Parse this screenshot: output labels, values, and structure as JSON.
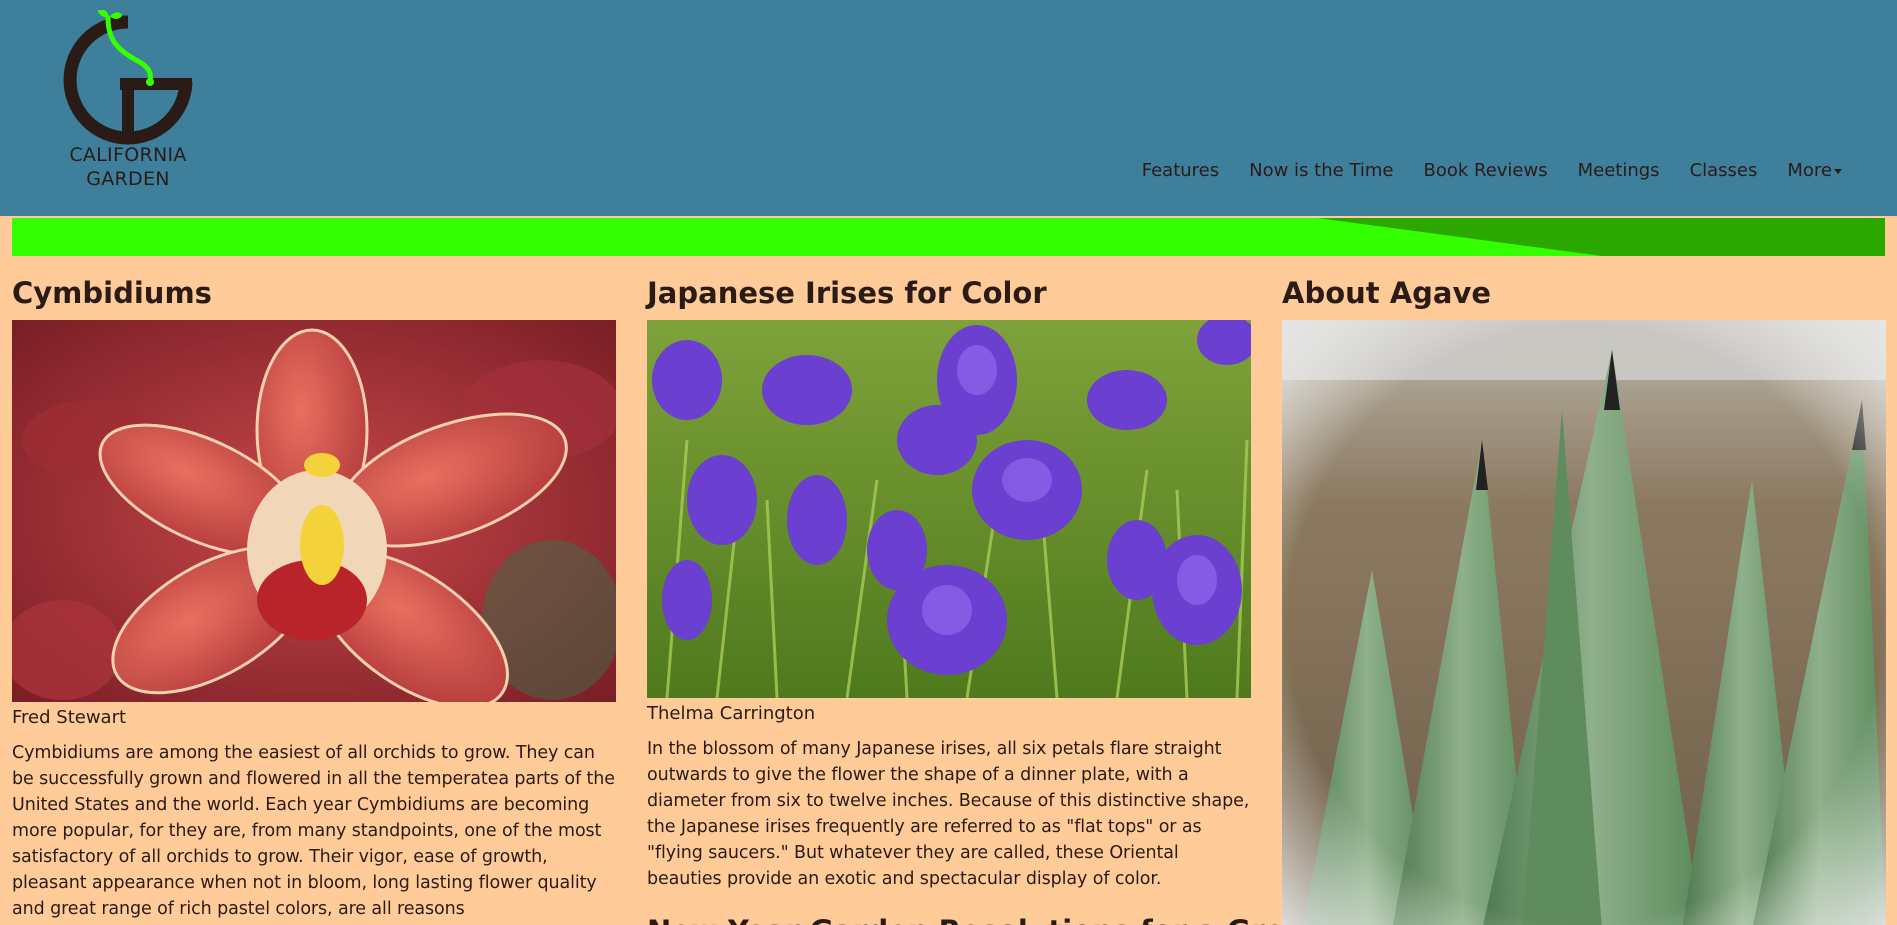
{
  "site": {
    "logo_line1": "CALIFORNIA",
    "logo_line2": "GARDEN",
    "colors": {
      "header": "#3e7f9b",
      "page": "#ffcc99",
      "banner": "#33ff00",
      "banner_dark": "#2aa800",
      "text": "#2b1b17"
    }
  },
  "nav": {
    "features": "Features",
    "now": "Now is the Time",
    "books": "Book Reviews",
    "meetings": "Meetings",
    "classes": "Classes",
    "more": "More"
  },
  "articles": [
    {
      "title": "Cymbidiums",
      "author": "Fred Stewart",
      "image_icon": "red-orchid-photo",
      "body": "Cymbidiums are among the easiest of all orchids to grow. They can be successfully grown and flowered in all the temperatea parts of the United States and the world. Each year Cymbidiums are becoming more popular, for they are, from many standpoints, one of the most satisfactory of all orchids to grow. Their vigor, ease of growth, pleasant appearance when not in bloom, long lasting flower quality and great range of rich pastel colors, are all reasons"
    },
    {
      "title": "Japanese Irises for Color",
      "author": "Thelma Carrington",
      "image_icon": "purple-iris-photo",
      "body": "In the blossom of many Japanese irises, all six petals flare straight outwards to give the flower the shape of a dinner plate, with a diameter from six to twelve inches. Because of this distinctive shape, the Japanese irises frequently are referred to as \"flat tops\" or as \"flying saucers.\" But whatever they are called, these Oriental beauties provide an exotic and spectacular display of color.",
      "next_title": "New Year Garden Resolutions for a Great"
    },
    {
      "title": "About Agave",
      "image_icon": "agave-plant-photo"
    }
  ]
}
